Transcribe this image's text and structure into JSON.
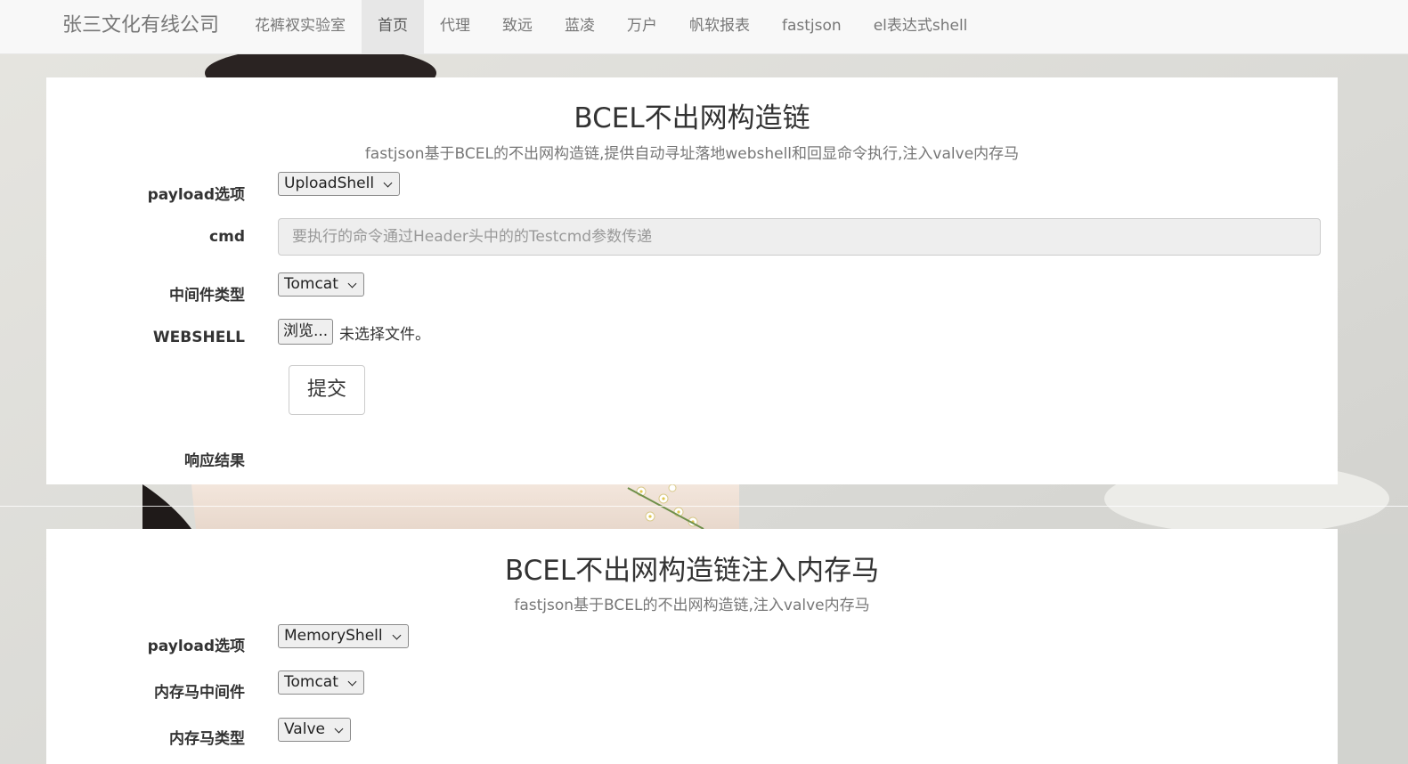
{
  "navbar": {
    "brand": "张三文化有线公司",
    "items": [
      {
        "label": "花裤衩实验室",
        "active": false
      },
      {
        "label": "首页",
        "active": true
      },
      {
        "label": "代理",
        "active": false
      },
      {
        "label": "致远",
        "active": false
      },
      {
        "label": "蓝凌",
        "active": false
      },
      {
        "label": "万户",
        "active": false
      },
      {
        "label": "帆软报表",
        "active": false
      },
      {
        "label": "fastjson",
        "active": false
      },
      {
        "label": "el表达式shell",
        "active": false
      }
    ]
  },
  "panel1": {
    "title": "BCEL不出网构造链",
    "subtitle": "fastjson基于BCEL的不出网构造链,提供自动寻址落地webshell和回显命令执行,注入valve内存马",
    "payload_label": "payload选项",
    "payload_value": "UploadShell",
    "cmd_label": "cmd",
    "cmd_placeholder": "要执行的命令通过Header头中的的Testcmd参数传递",
    "middleware_label": "中间件类型",
    "middleware_value": "Tomcat",
    "webshell_label": "WEBSHELL",
    "browse_label": "浏览...",
    "file_status": "未选择文件。",
    "submit_label": "提交",
    "result_label": "响应结果"
  },
  "panel2": {
    "title": "BCEL不出网构造链注入内存马",
    "subtitle": "fastjson基于BCEL的不出网构造链,注入valve内存马",
    "payload_label": "payload选项",
    "payload_value": "MemoryShell",
    "middleware_label": "内存马中间件",
    "middleware_value": "Tomcat",
    "type_label": "内存马类型",
    "type_value": "Valve"
  }
}
